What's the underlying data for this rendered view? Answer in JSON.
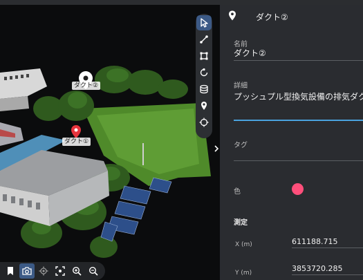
{
  "viewport": {
    "markers": [
      {
        "label": "ダクト②",
        "color": "#ffffff"
      },
      {
        "label": "ダクト①",
        "color": "#e5343d"
      }
    ],
    "toolbar": [
      {
        "icon": "pointer-icon",
        "active": true
      },
      {
        "icon": "polyline-icon",
        "active": false
      },
      {
        "icon": "polygon-icon",
        "active": false
      },
      {
        "icon": "circle-measure-icon",
        "active": false
      },
      {
        "icon": "volume-icon",
        "active": false
      },
      {
        "icon": "map-pin-icon",
        "active": false
      },
      {
        "icon": "crosshair-icon",
        "active": false
      }
    ],
    "bottom_tools": [
      {
        "icon": "bookmark-icon",
        "active": false
      },
      {
        "icon": "camera-icon",
        "active": true
      },
      {
        "icon": "locate-icon",
        "active": false
      },
      {
        "icon": "fit-view-icon",
        "active": false
      },
      {
        "icon": "zoom-in-icon",
        "active": false
      },
      {
        "icon": "zoom-out-icon",
        "active": false
      }
    ]
  },
  "panel": {
    "title": "ダクト②",
    "name_label": "名前",
    "name_value": "ダクト②",
    "detail_label": "詳細",
    "detail_value": "プッシュプル型換気設備の排気ダクト",
    "tag_label": "タグ",
    "tag_value": "",
    "color_label": "色",
    "color_value": "#ff4f7b",
    "measure_label": "測定",
    "x_label": "X (m)",
    "x_value": "611188.715",
    "y_label": "Y (m)",
    "y_value": "3853720.285"
  }
}
